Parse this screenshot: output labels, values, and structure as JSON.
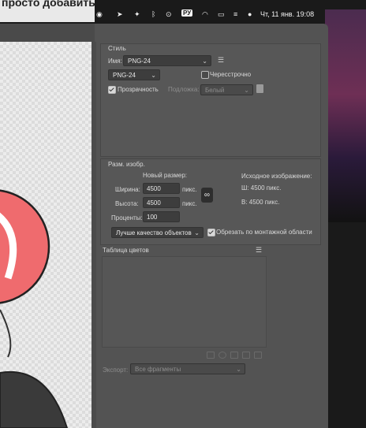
{
  "top": {
    "left_text": "просто добавить",
    "menubar": {
      "lang": "РУ",
      "clock": "Чт, 11 янв.  19:08"
    }
  },
  "style_panel": {
    "heading": "Стиль",
    "name_label": "Имя:",
    "name_value": "PNG-24",
    "format_value": "PNG-24",
    "interlaced_label": "Чересстрочно",
    "interlaced_checked": false,
    "transparency_label": "Прозрачность",
    "transparency_checked": true,
    "matte_label": "Подложка:",
    "matte_value": "Белый"
  },
  "size_panel": {
    "heading": "Разм. изобр.",
    "new_size_label": "Новый размер:",
    "width_label": "Ширина:",
    "width_value": "4500",
    "width_unit": "пикс.",
    "height_label": "Высота:",
    "height_value": "4500",
    "height_unit": "пикс.",
    "percent_label": "Проценты:",
    "percent_value": "100",
    "original_label": "Исходное изображение:",
    "orig_w": "Ш:  4500 пикс.",
    "orig_h": "В:   4500 пикс.",
    "quality_value": "Лучше качество объектов",
    "clip_label": "Обрезать по монтажной области",
    "clip_checked": true
  },
  "color_table": {
    "heading": "Таблица цветов"
  },
  "export": {
    "label": "Экспорт:",
    "value": "Все фрагменты"
  },
  "colors": {
    "dialog_bg": "#535353",
    "panel_bg": "#575757",
    "field_bg": "#3d3d3d",
    "salmon": "#ef6b6e",
    "text": "#d8d8d8"
  }
}
